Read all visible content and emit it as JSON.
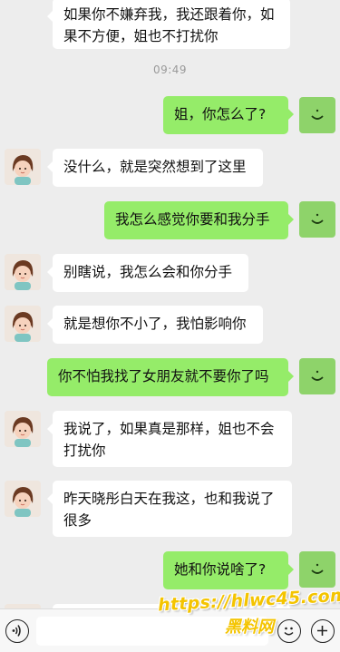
{
  "timestamp": "09:49",
  "messages": [
    {
      "side": "in",
      "lines": [
        "如果你不嫌弃我，我还跟着你，如",
        "果不方便，姐也不打扰你"
      ]
    },
    {
      "side": "out",
      "text": "姐，你怎么了?"
    },
    {
      "side": "in",
      "text": "没什么，就是突然想到了这里"
    },
    {
      "side": "out",
      "text": "我怎么感觉你要和我分手"
    },
    {
      "side": "in",
      "text": "别瞎说，我怎么会和你分手"
    },
    {
      "side": "in",
      "text": "就是想你不小了，我怕影响你"
    },
    {
      "side": "out",
      "text": "你不怕我找了女朋友就不要你了吗"
    },
    {
      "side": "in",
      "lines": [
        "我说了，如果真是那样，姐也不会",
        "打扰你"
      ]
    },
    {
      "side": "in",
      "lines": [
        "昨天晓彤白天在我这，也和我说了",
        "很多"
      ]
    },
    {
      "side": "out",
      "text": "她和你说啥了?"
    }
  ],
  "input": {
    "value": "",
    "placeholder": ""
  },
  "icons": {
    "voice": "voice-icon",
    "emoji": "emoji-icon",
    "more": "plus-icon"
  },
  "watermark": {
    "line1": "https://hlwc45.com",
    "line2": "黑料网"
  },
  "colors": {
    "background": "#ededed",
    "incoming_bubble": "#ffffff",
    "outgoing_bubble": "#95ec69",
    "timestamp": "#9a9a9a",
    "watermark_text": "#f4c400"
  }
}
